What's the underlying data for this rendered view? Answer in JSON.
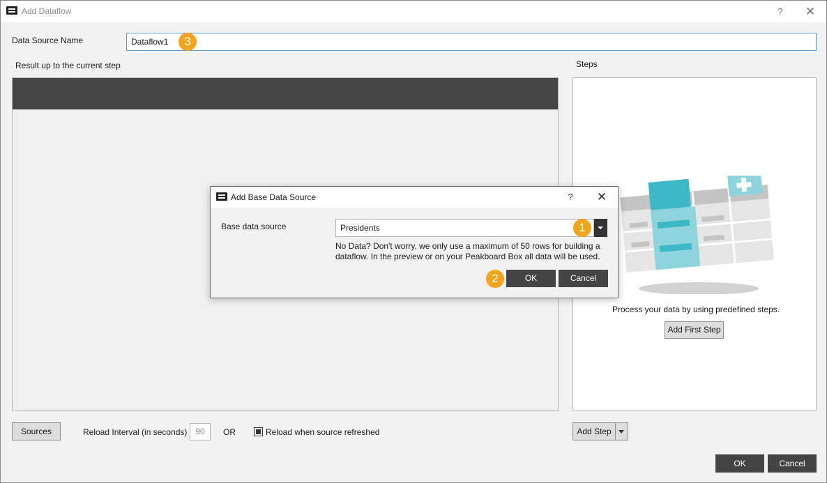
{
  "window": {
    "title": "Add Dataflow",
    "help_label": "?",
    "close_label": "✕"
  },
  "form": {
    "name_label": "Data Source Name",
    "name_value": "Dataflow1"
  },
  "result": {
    "label": "Result up to the current step"
  },
  "steps": {
    "label": "Steps",
    "empty_message": "Process your data by using predefined steps.",
    "add_first_step_label": "Add First Step",
    "add_step_label": "Add Step"
  },
  "bottom": {
    "sources_label": "Sources",
    "reload_interval_label": "Reload Interval (in seconds)",
    "reload_interval_value": "90",
    "or_label": "OR",
    "reload_refreshed_label": "Reload when source refreshed",
    "reload_refreshed_checked": true,
    "ok_label": "OK",
    "cancel_label": "Cancel"
  },
  "dialog": {
    "title": "Add Base Data Source",
    "help_label": "?",
    "close_label": "✕",
    "base_source_label": "Base data source",
    "base_source_value": "Presidents",
    "info_text": "No Data? Don't worry, we only use a maximum of 50 rows for building a dataflow. In the preview or on your Peakboard Box all data will be used.",
    "ok_label": "OK",
    "cancel_label": "Cancel"
  },
  "badges": {
    "one": "1",
    "two": "2",
    "three": "3"
  },
  "colors": {
    "badge": "#f2a41c",
    "teal": "#3db8c6",
    "dark_header": "#454545",
    "dark_button": "#444444"
  }
}
